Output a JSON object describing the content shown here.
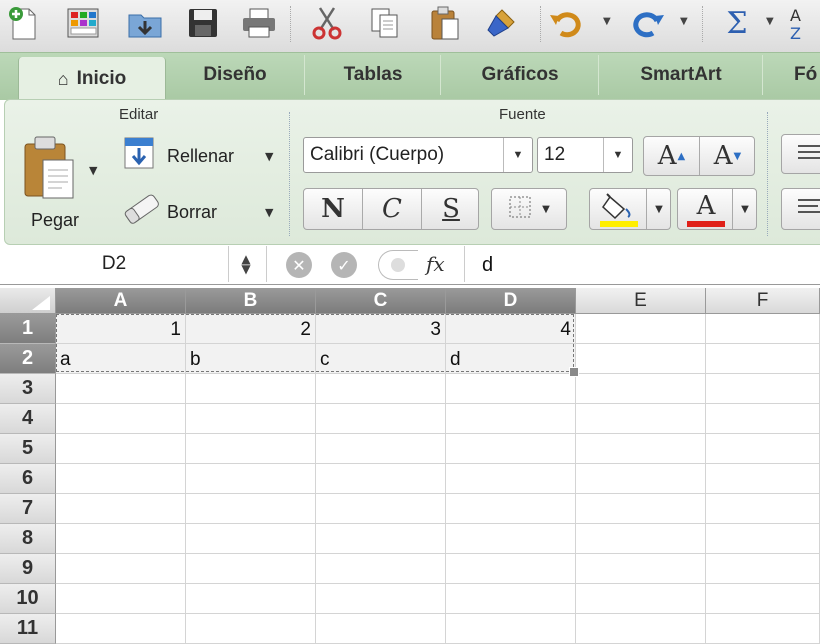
{
  "tabs": [
    {
      "label": "Inicio",
      "active": true
    },
    {
      "label": "Diseño"
    },
    {
      "label": "Tablas"
    },
    {
      "label": "Gráficos"
    },
    {
      "label": "SmartArt"
    },
    {
      "label": "Fó"
    }
  ],
  "ribbon": {
    "edit_group": "Editar",
    "font_group": "Fuente",
    "paste_label": "Pegar",
    "fill_label": "Rellenar",
    "clear_label": "Borrar",
    "font_name": "Calibri (Cuerpo)",
    "font_size": "12",
    "bold_label": "N",
    "italic_label": "C",
    "underline_label": "S",
    "grow_font": "A",
    "shrink_font": "A",
    "font_color_letter": "A",
    "highlight_color": "#ffee00",
    "font_color": "#e0201a"
  },
  "formula_bar": {
    "name_box": "D2",
    "fx": "fx",
    "content": "d"
  },
  "sheet": {
    "columns": [
      "A",
      "B",
      "C",
      "D",
      "E",
      "F"
    ],
    "rows": [
      "1",
      "2",
      "3",
      "4",
      "5",
      "6",
      "7",
      "8",
      "9",
      "10",
      "11"
    ],
    "cells": {
      "A1": "1",
      "B1": "2",
      "C1": "3",
      "D1": "4",
      "A2": "a",
      "B2": "b",
      "C2": "c",
      "D2": "d"
    }
  }
}
